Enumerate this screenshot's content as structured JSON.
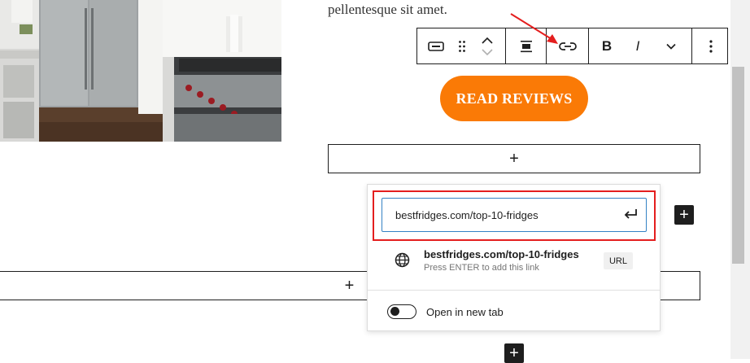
{
  "content": {
    "paragraph_tail": "pellentesque sit amet.",
    "image_alt": "Kitchen with stainless refrigerator and range"
  },
  "toolbar": {
    "bold_label": "B",
    "italic_label": "I",
    "icons": [
      "button-block-icon",
      "drag-handle-icon",
      "move-up-icon",
      "move-down-icon",
      "justify-icon",
      "link-icon",
      "more-rich-text-chevron-icon",
      "options-kebab-icon"
    ]
  },
  "cta": {
    "label": "READ REVIEWS",
    "color": "#fa7a06"
  },
  "appenders": {
    "plus": "+"
  },
  "link_popover": {
    "input_value": "bestfridges.com/top-10-fridges",
    "suggestion_title": "bestfridges.com/top-10-fridges",
    "suggestion_hint": "Press ENTER to add this link",
    "suggestion_type": "URL",
    "new_tab_label": "Open in new tab",
    "new_tab_enabled": false
  },
  "colors": {
    "highlight": "#e41e1e",
    "input_focus": "#3582c4",
    "annotation_arrow": "#e41e1e"
  }
}
